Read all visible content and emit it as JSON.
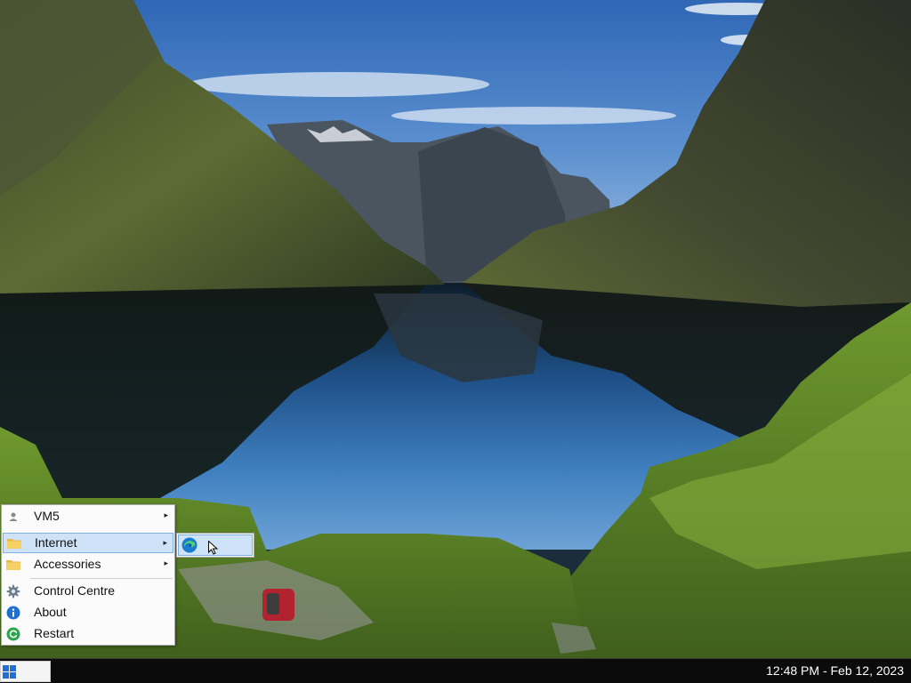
{
  "start_menu": {
    "items": [
      {
        "label": "VM5",
        "icon": "user-icon",
        "has_submenu": true
      },
      {
        "label": "Internet",
        "icon": "folder-icon",
        "has_submenu": true,
        "active": true
      },
      {
        "label": "Accessories",
        "icon": "folder-icon",
        "has_submenu": true
      },
      {
        "label": "Control Centre",
        "icon": "gear-icon",
        "has_submenu": false
      },
      {
        "label": "About",
        "icon": "info-icon",
        "has_submenu": false
      },
      {
        "label": "Restart",
        "icon": "restart-icon",
        "has_submenu": false
      }
    ],
    "submenu_arrow": "▸"
  },
  "internet_submenu": {
    "items": [
      {
        "icon": "edge-browser-icon",
        "label": ""
      }
    ]
  },
  "taskbar": {
    "start_icon": "windows-logo-icon",
    "clock": "12:48 PM - Feb 12, 2023"
  },
  "colors": {
    "menu_highlight": "#cfe3f8",
    "menu_highlight_border": "#7eb0e0",
    "taskbar": "#0b0b0b",
    "windows_logo": "#1f6fd8"
  }
}
